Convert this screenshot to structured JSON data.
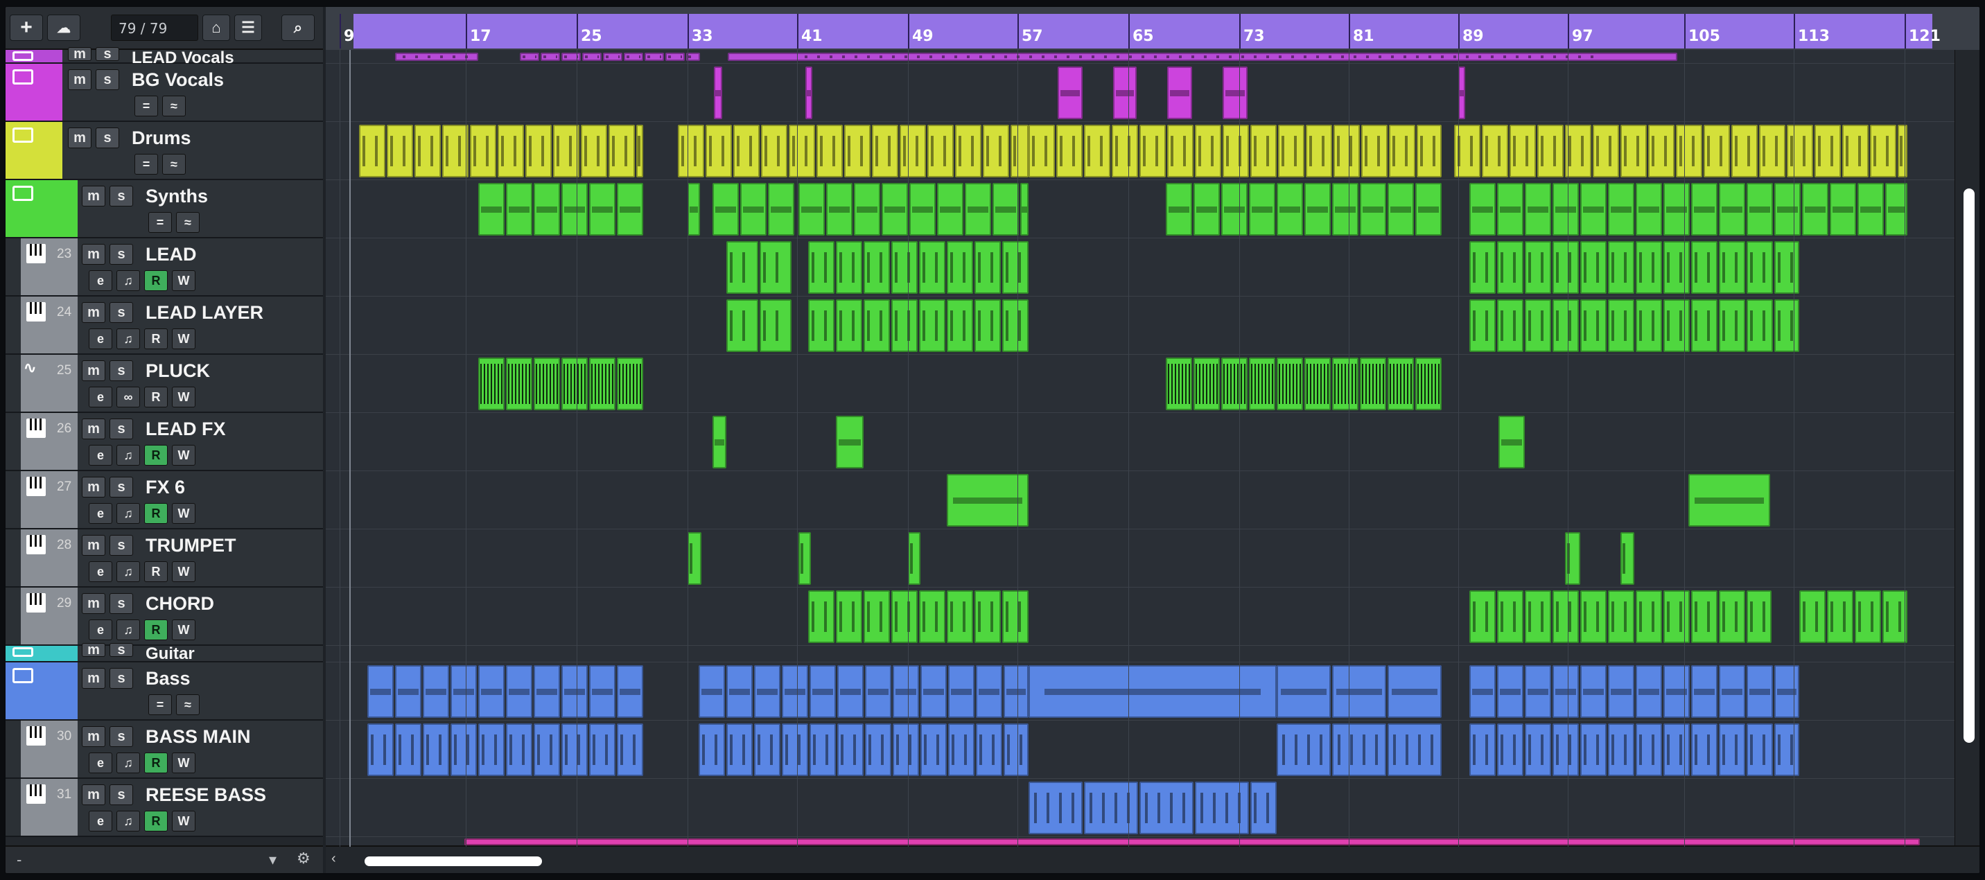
{
  "toolbar": {
    "add_label": "+",
    "track_counter": "79 / 79"
  },
  "colors": {
    "ruler": "#9473e6",
    "vocals": "#b64ad6",
    "bgvocals": "#cc44dd",
    "drums": "#d4e03a",
    "synth": "#4fd73f",
    "guitar": "#3cc8c8",
    "bass": "#5a86e4",
    "pink": "#e040b0"
  },
  "ruler": {
    "bars": [
      "9",
      "17",
      "25",
      "33",
      "41",
      "49",
      "57",
      "65",
      "73",
      "81",
      "89",
      "97",
      "105",
      "113",
      "121"
    ]
  },
  "tracks": [
    {
      "name": "LEAD Vocals",
      "num": "",
      "type": "folder",
      "color": "#b64ad6"
    },
    {
      "name": "BG Vocals",
      "num": "",
      "type": "folder",
      "color": "#cc44dd"
    },
    {
      "name": "Drums",
      "num": "",
      "type": "folder",
      "color": "#d4e03a"
    },
    {
      "name": "Synths",
      "num": "",
      "type": "folder-open",
      "color": "#4fd73f"
    },
    {
      "name": "LEAD",
      "num": "23",
      "type": "instrument",
      "color": "#8a8f96"
    },
    {
      "name": "LEAD LAYER",
      "num": "24",
      "type": "instrument",
      "color": "#8a8f96"
    },
    {
      "name": "PLUCK",
      "num": "25",
      "type": "audio",
      "color": "#8a8f96"
    },
    {
      "name": "LEAD FX",
      "num": "26",
      "type": "instrument",
      "color": "#8a8f96"
    },
    {
      "name": "FX 6",
      "num": "27",
      "type": "instrument",
      "color": "#8a8f96"
    },
    {
      "name": "TRUMPET",
      "num": "28",
      "type": "instrument",
      "color": "#8a8f96"
    },
    {
      "name": "CHORD",
      "num": "29",
      "type": "instrument",
      "color": "#8a8f96"
    },
    {
      "name": "Guitar",
      "num": "",
      "type": "folder-open",
      "color": "#3cc8c8"
    },
    {
      "name": "Bass",
      "num": "",
      "type": "folder-open",
      "color": "#5a86e4"
    },
    {
      "name": "BASS MAIN",
      "num": "30",
      "type": "instrument",
      "color": "#8a8f96"
    },
    {
      "name": "REESE BASS",
      "num": "31",
      "type": "instrument",
      "color": "#8a8f96"
    }
  ],
  "buttons": {
    "mute": "m",
    "solo": "s",
    "edit": "e",
    "read": "R",
    "write": "W",
    "equals": "=",
    "loop": "∞"
  },
  "footer": {
    "minus": "-"
  }
}
